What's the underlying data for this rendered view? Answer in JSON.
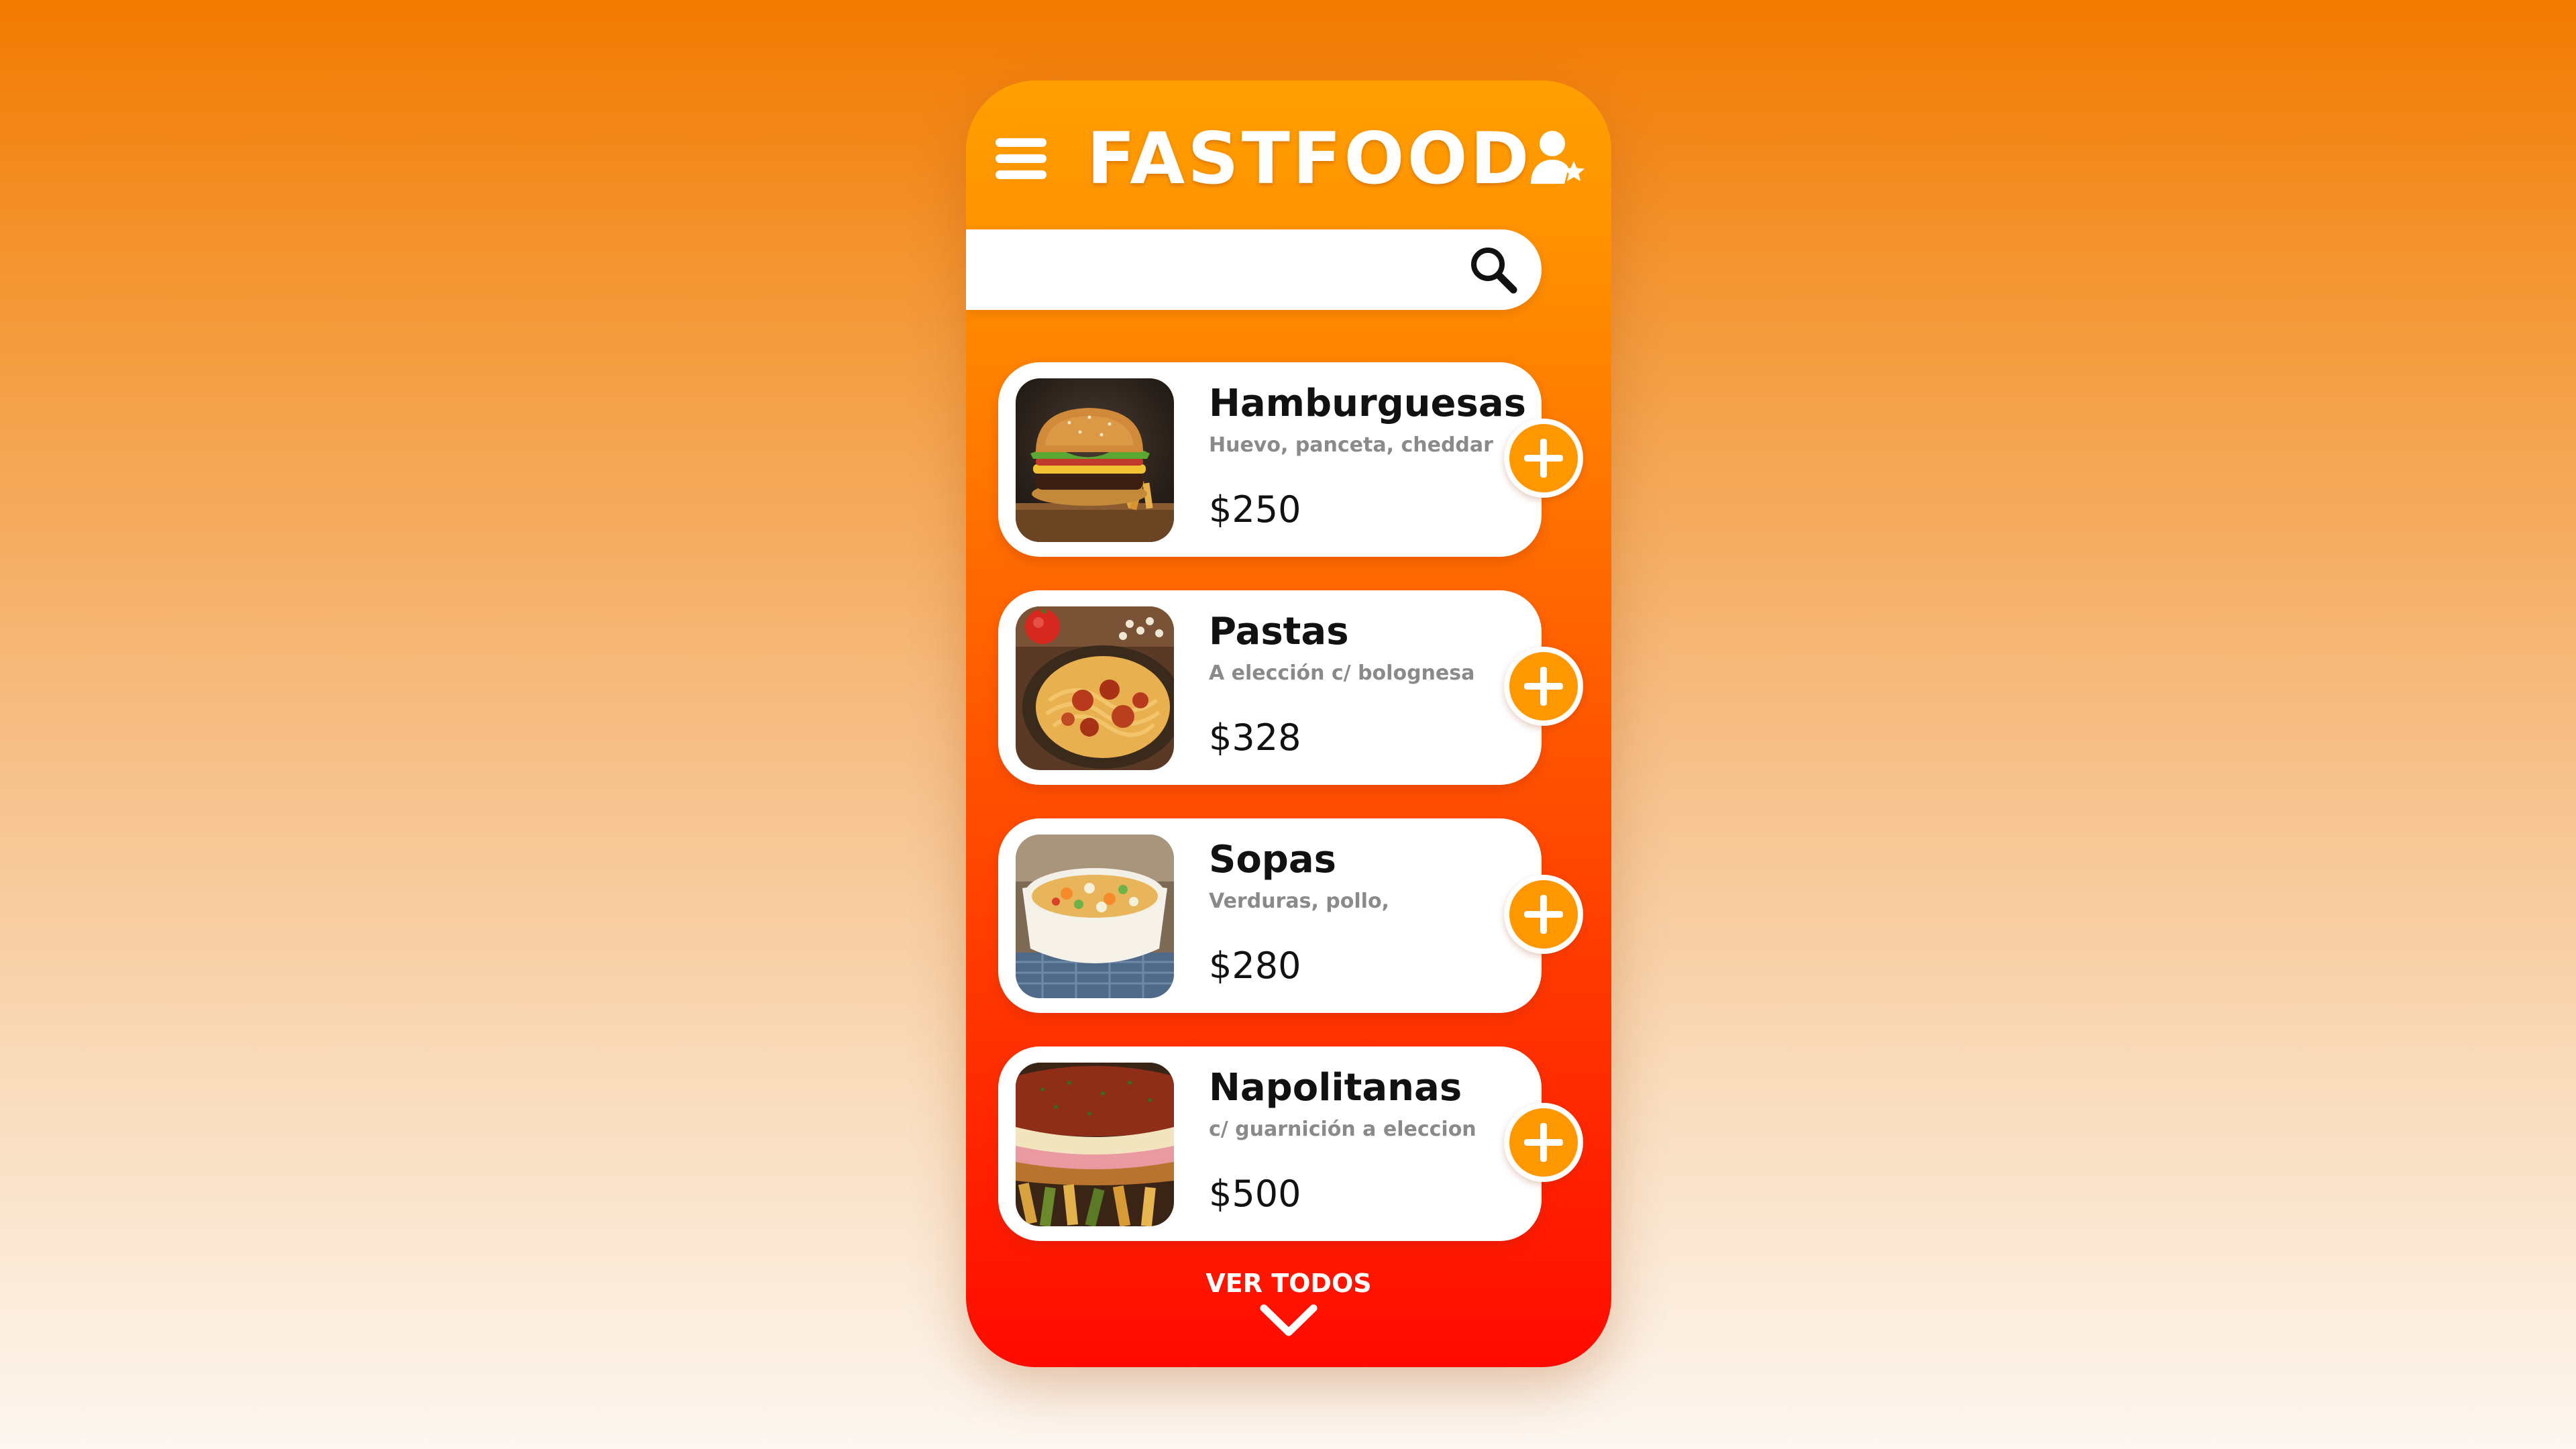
{
  "header": {
    "title": "FASTFOOD",
    "menu_icon": "hamburger-menu-icon",
    "profile_icon": "user-star-icon"
  },
  "search": {
    "placeholder": "",
    "value": "",
    "icon": "search-icon"
  },
  "items": [
    {
      "name": "Hamburguesas",
      "description": "Huevo, panceta, cheddar",
      "price": "$250",
      "image": "burger-photo"
    },
    {
      "name": "Pastas",
      "description": "A elección c/ bolognesa",
      "price": "$328",
      "image": "pasta-photo"
    },
    {
      "name": "Sopas",
      "description": "Verduras, pollo,",
      "price": "$280",
      "image": "soup-photo"
    },
    {
      "name": "Napolitanas",
      "description": "c/ guarnición a eleccion",
      "price": "$500",
      "image": "milanesa-napolitana-photo"
    }
  ],
  "footer": {
    "view_all_label": "VER TODOS",
    "icon": "chevron-down-icon"
  },
  "colors": {
    "accent": "#ff9800",
    "phone_top": "#ffa000",
    "phone_bottom": "#ff0a00",
    "card": "#ffffff"
  }
}
